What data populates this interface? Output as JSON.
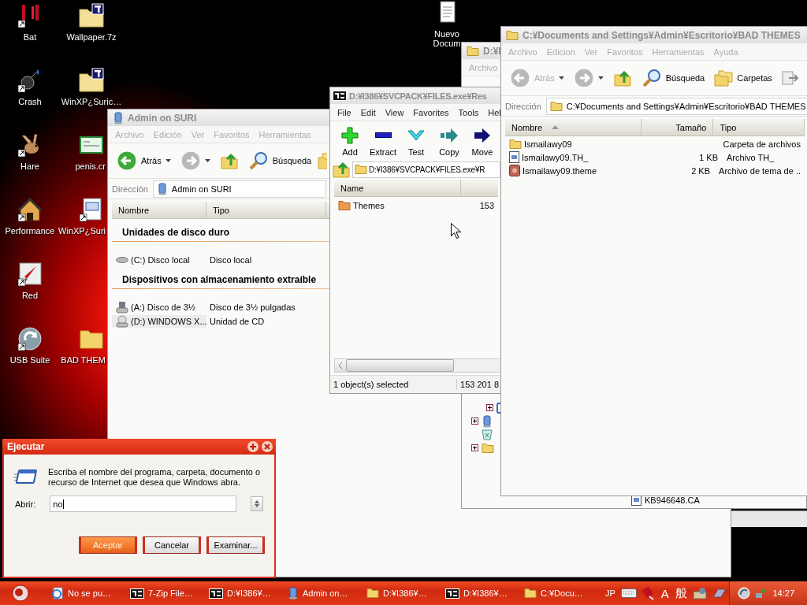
{
  "desktop_icons": [
    {
      "label": "Bat",
      "shortcut": true
    },
    {
      "label": "Wallpaper.7z",
      "shortcut": false
    },
    {
      "label": "Nuevo Docum",
      "shortcut": false
    },
    {
      "label": "Crash",
      "shortcut": true
    },
    {
      "label": "WinXP¿Suric…",
      "shortcut": false
    },
    {
      "label": "Hare",
      "shortcut": true
    },
    {
      "label": "penis.cr",
      "shortcut": false
    },
    {
      "label": "Performance",
      "shortcut": true
    },
    {
      "label": "WinXP¿Suri",
      "shortcut": true
    },
    {
      "label": "Red",
      "shortcut": true
    },
    {
      "label": "USB Suite",
      "shortcut": true
    },
    {
      "label": "BAD THEM",
      "shortcut": false
    }
  ],
  "windows": [
    {
      "kind": "drives",
      "title": "Admin on SURI",
      "menus": [
        {
          "label": "Archivo",
          "disabled": true
        },
        {
          "label": "Edición",
          "disabled": true
        },
        {
          "label": "Ver",
          "disabled": true
        },
        {
          "label": "Favoritos",
          "disabled": true
        },
        {
          "label": "Herramientas",
          "disabled": true
        }
      ],
      "toolbar": [
        {
          "kind": "back",
          "label": "Atrás",
          "disabled": false
        },
        {
          "kind": "forward",
          "disabled": true
        },
        {
          "kind": "up"
        },
        {
          "kind": "search",
          "label": "Búsqueda"
        },
        {
          "kind": "folders"
        }
      ],
      "address_label": "Dirección",
      "address": "Admin on SURI",
      "columns": [
        {
          "label": "Nombre",
          "sorted": false
        },
        {
          "label": "Tipo",
          "sorted": false
        }
      ],
      "groups": [
        {
          "title": "Unidades de disco duro",
          "items": [
            {
              "name": "(C:) Disco local",
              "type": "Disco local",
              "selected": false
            }
          ]
        },
        {
          "title": "Dispositivos con almacenamiento extraíble",
          "items": [
            {
              "name": "(A:) Disco de 3½",
              "type": "Disco de 3½ pulgadas",
              "selected": false
            },
            {
              "name": "(D:) WINDOWS X...",
              "type": "Unidad de CD",
              "selected": true
            }
          ]
        }
      ]
    },
    {
      "kind": "background",
      "title": "D:¥I",
      "menus": [
        {
          "label": "Archivo",
          "disabled": true
        }
      ],
      "tree": [
        {
          "children": [
            {
              "kind": "node",
              "expanded": false
            }
          ]
        },
        {
          "kind": "node",
          "expanded": false
        },
        {
          "kind": "leaf"
        },
        {
          "kind": "node",
          "expanded": false
        }
      ],
      "files": [
        {
          "name": "KB946648.CA"
        }
      ]
    },
    {
      "kind": "sevenzip",
      "title": "D:¥I386¥SVCPACK¥FILES.exe¥Res",
      "menus": [
        {
          "label": "File",
          "disabled": false
        },
        {
          "label": "Edit",
          "disabled": false
        },
        {
          "label": "View",
          "disabled": false
        },
        {
          "label": "Favorites",
          "disabled": false
        },
        {
          "label": "Tools",
          "disabled": false
        },
        {
          "label": "Hel",
          "disabled": false
        }
      ],
      "toolbar": [
        {
          "kind": "add",
          "label": "Add"
        },
        {
          "kind": "extract",
          "label": "Extract"
        },
        {
          "kind": "test",
          "label": "Test"
        },
        {
          "kind": "copy",
          "label": "Copy"
        },
        {
          "kind": "move",
          "label": "Move"
        }
      ],
      "path": "D:¥I386¥SVCPACK¥FILES.exe¥R",
      "columns": [
        {
          "label": "Name"
        }
      ],
      "rows": [
        {
          "name": "Themes",
          "column_2": "153"
        }
      ],
      "status": [
        "1 object(s) selected",
        "153 201 8"
      ]
    },
    {
      "kind": "files",
      "title": "C:¥Documents and Settings¥Admin¥Escritorio¥BAD THEMES",
      "menus": [
        {
          "label": "Archivo",
          "disabled": true
        },
        {
          "label": "Edicion",
          "disabled": true
        },
        {
          "label": "Ver",
          "disabled": true
        },
        {
          "label": "Favoritos",
          "disabled": true
        },
        {
          "label": "Herramientas",
          "disabled": true
        },
        {
          "label": "Ayuda",
          "disabled": true
        }
      ],
      "toolbar": [
        {
          "kind": "back",
          "label": "Atrás",
          "disabled": true
        },
        {
          "kind": "forward",
          "disabled": true
        },
        {
          "kind": "up"
        },
        {
          "kind": "search",
          "label": "Búsqueda"
        },
        {
          "kind": "folders",
          "label": "Carpetas"
        },
        {
          "kind": "moveto"
        }
      ],
      "address_label": "Dirección",
      "address": "C:¥Documents and Settings¥Admin¥Escritorio¥BAD THEMES",
      "columns": [
        {
          "label": "Nombre",
          "sorted": true
        },
        {
          "label": "Tamaño",
          "sorted": false
        },
        {
          "label": "Tipo",
          "sorted": false
        }
      ],
      "rows": [
        {
          "kind": "folder",
          "name": "Ismailawy09",
          "size": "",
          "type": "Carpeta de archivos"
        },
        {
          "kind": "file",
          "name": "Ismailawy09.TH_",
          "size": "1 KB",
          "type": "Archivo TH_"
        },
        {
          "kind": "theme",
          "name": "Ismailawy09.theme",
          "size": "2 KB",
          "type": "Archivo de tema de .."
        }
      ]
    }
  ],
  "run_dialog": {
    "title": "Ejecutar",
    "message": "Escriba el nombre del programa, carpeta, documento o recurso de Internet que desea que Windows abra.",
    "open_label": "Abrir:",
    "open_value": "no",
    "buttons": [
      {
        "label": "Aceptar",
        "default": true
      },
      {
        "label": "Cancelar",
        "default": false
      },
      {
        "label": "Examinar...",
        "default": false
      }
    ]
  },
  "taskbar": {
    "items": [
      {
        "label": "No se pu…"
      },
      {
        "label": "7-Zip File…"
      },
      {
        "label": "D:¥I386¥…"
      },
      {
        "label": "Admin on…"
      },
      {
        "label": "D:¥I386¥…"
      },
      {
        "label": "D:¥I386¥…"
      },
      {
        "label": "C:¥Docu…"
      }
    ],
    "language": "JP",
    "ime_mode": "A",
    "ime_input": "般",
    "time": "14:27"
  }
}
